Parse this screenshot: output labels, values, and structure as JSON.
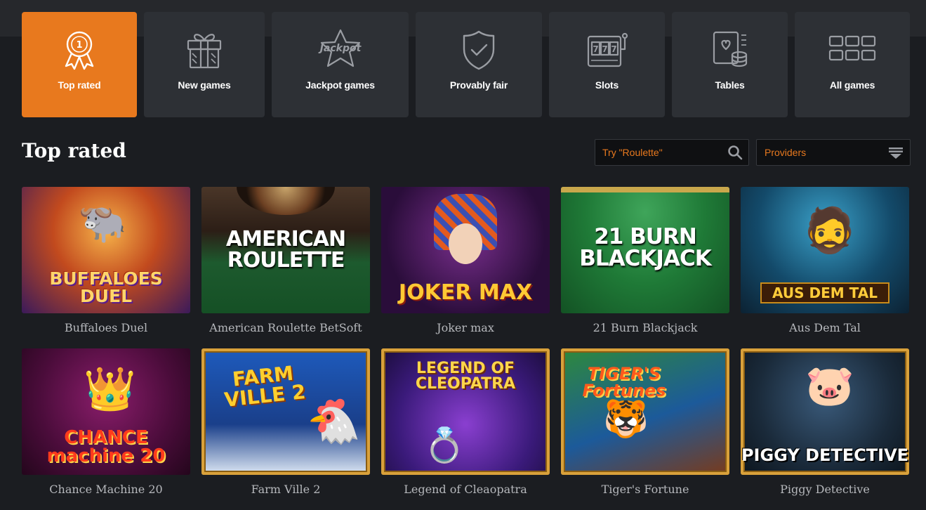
{
  "categories": [
    {
      "label": "Top rated",
      "icon": "ribbon-medal-icon",
      "active": true
    },
    {
      "label": "New games",
      "icon": "gift-icon",
      "active": false
    },
    {
      "label": "Jackpot games",
      "icon": "jackpot-star-icon",
      "active": false
    },
    {
      "label": "Provably fair",
      "icon": "shield-check-icon",
      "active": false
    },
    {
      "label": "Slots",
      "icon": "slot-machine-icon",
      "active": false
    },
    {
      "label": "Tables",
      "icon": "cards-chips-icon",
      "active": false
    },
    {
      "label": "All games",
      "icon": "grid-icon",
      "active": false
    }
  ],
  "section_title": "Top rated",
  "search": {
    "placeholder": "Try \"Roulette\"",
    "icon": "search-icon"
  },
  "providers": {
    "label": "Providers",
    "icon": "filter-icon"
  },
  "games": [
    {
      "name": "Buffaloes Duel",
      "art": "BUFFALOES DUEL"
    },
    {
      "name": "American Roulette BetSoft",
      "art": "AMERICAN ROULETTE"
    },
    {
      "name": "Joker max",
      "art": "JOKER MAX"
    },
    {
      "name": "21 Burn Blackjack",
      "art": "21 BURN BLACKJACK"
    },
    {
      "name": "Aus Dem Tal",
      "art": "AUS DEM TAL"
    },
    {
      "name": "Chance Machine 20",
      "art": "CHANCE machine 20"
    },
    {
      "name": "Farm Ville 2",
      "art": "FARM VILLE 2"
    },
    {
      "name": "Legend of Cleaopatra",
      "art": "LEGEND OF CLEOPATRA"
    },
    {
      "name": "Tiger's Fortune",
      "art": "TIGER'S Fortunes"
    },
    {
      "name": "Piggy Detective",
      "art": "PIGGY DETECTIVE"
    }
  ],
  "colors": {
    "accent": "#e8791e",
    "tile": "#2d3035",
    "background": "#1b1d21"
  }
}
